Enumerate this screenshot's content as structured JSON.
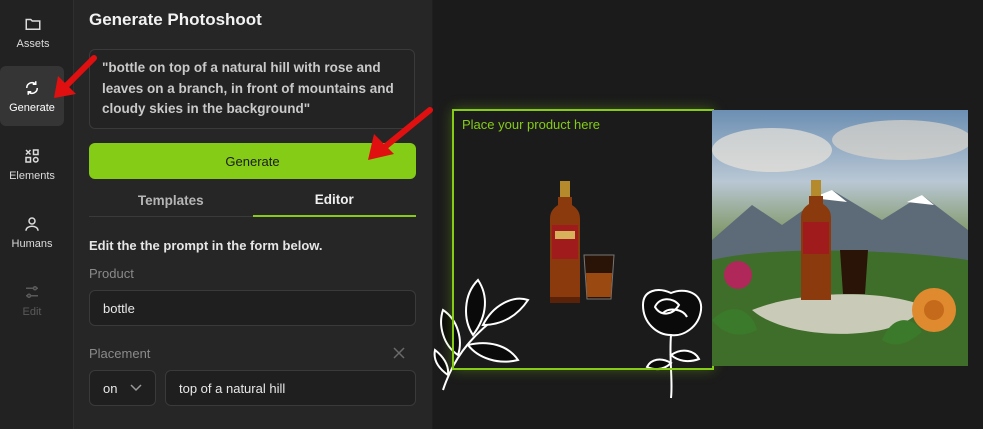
{
  "sidebar": {
    "items": [
      {
        "label": "Assets",
        "icon": "folder-icon",
        "state": "normal"
      },
      {
        "label": "Generate",
        "icon": "refresh-icon",
        "state": "active"
      },
      {
        "label": "Elements",
        "icon": "elements-icon",
        "state": "normal"
      },
      {
        "label": "Humans",
        "icon": "person-icon",
        "state": "normal"
      },
      {
        "label": "Edit",
        "icon": "sliders-icon",
        "state": "disabled"
      }
    ]
  },
  "panel": {
    "title": "Generate Photoshoot",
    "prompt": "\"bottle on top of a natural hill with rose and leaves on a branch, in front of mountains and cloudy skies in the background\"",
    "generate_label": "Generate",
    "tabs": [
      {
        "label": "Templates",
        "active": false
      },
      {
        "label": "Editor",
        "active": true
      }
    ],
    "form_heading": "Edit the the prompt in the form below.",
    "product_label": "Product",
    "product_value": "bottle",
    "placement_label": "Placement",
    "placement_preposition": "on",
    "placement_value": "top of a natural hill"
  },
  "canvas": {
    "dropzone_label": "Place your product here"
  },
  "colors": {
    "accent": "#84cc16",
    "annotation_arrow": "#e01010",
    "panel_bg": "#262626",
    "canvas_bg": "#1b1b1b"
  }
}
